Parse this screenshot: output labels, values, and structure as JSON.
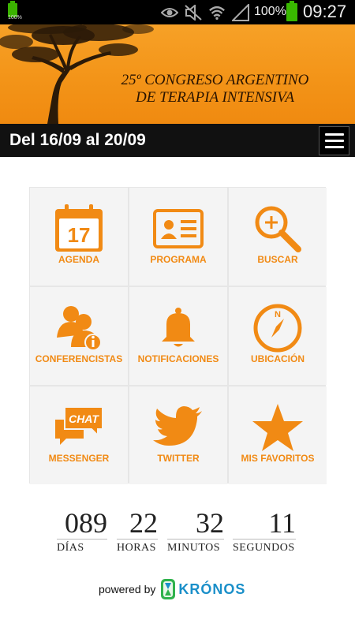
{
  "status_bar": {
    "small_battery_pct": "100%",
    "battery_pct": "100%",
    "time": "09:27",
    "icons": [
      "eye-icon",
      "mute-icon",
      "wifi-icon",
      "signal-icon"
    ]
  },
  "banner": {
    "title_line1": "25º CONGRESO ARGENTINO",
    "title_line2": "DE TERAPIA INTENSIVA"
  },
  "date_bar": {
    "text": "Del 16/09 al 20/09",
    "menu_icon": "hamburger-icon"
  },
  "tiles": [
    {
      "label": "AGENDA",
      "icon": "calendar-icon",
      "calendar_day": "17"
    },
    {
      "label": "PROGRAMA",
      "icon": "id-card-icon"
    },
    {
      "label": "BUSCAR",
      "icon": "magnifier-plus-icon"
    },
    {
      "label": "CONFERENCISTAS",
      "icon": "speakers-info-icon"
    },
    {
      "label": "NOTIFICACIONES",
      "icon": "bell-icon"
    },
    {
      "label": "UBICACIÓN",
      "icon": "compass-icon",
      "compass_letter": "N"
    },
    {
      "label": "MESSENGER",
      "icon": "chat-bubbles-icon",
      "chat_text": "CHAT"
    },
    {
      "label": "TWITTER",
      "icon": "twitter-bird-icon"
    },
    {
      "label": "MIS FAVORITOS",
      "icon": "star-icon"
    }
  ],
  "countdown": {
    "days": "089",
    "days_label": "DÍAS",
    "hours": "22",
    "hours_label": "HORAS",
    "minutes": "32",
    "minutes_label": "MINUTOS",
    "seconds": "11",
    "seconds_label": "SEGUNDOS"
  },
  "footer": {
    "powered_by": "powered by",
    "brand": "KRÓNOS"
  },
  "colors": {
    "accent": "#f18a14",
    "banner": "#f39418",
    "datebar": "#111111",
    "brand": "#1a8fc9"
  }
}
